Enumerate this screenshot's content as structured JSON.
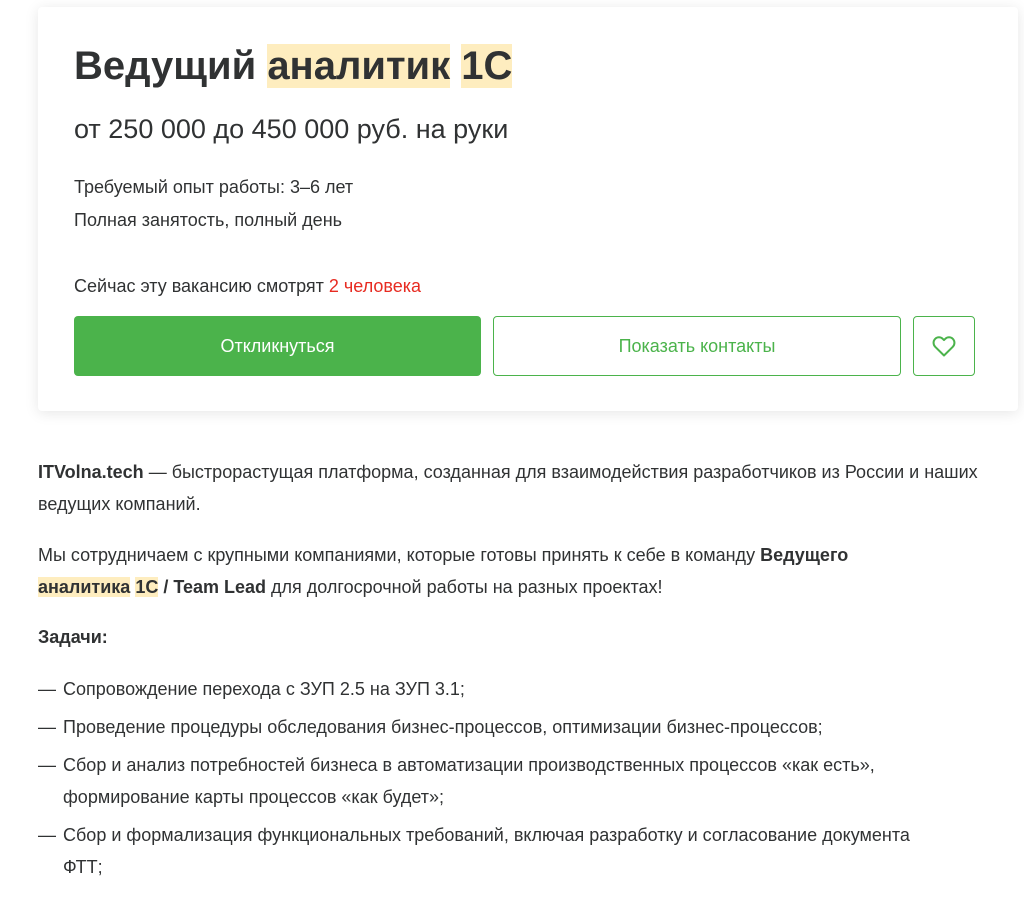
{
  "vacancy": {
    "title_part1": "Ведущий",
    "title_part2": "аналитик",
    "title_part3": "1С",
    "salary": "от 250 000 до 450 000 руб. на руки",
    "experience": "Требуемый опыт работы: 3–6 лет",
    "employment": "Полная занятость, полный день",
    "viewers_text": "Сейчас эту вакансию смотрят",
    "viewers_count": "2 человека"
  },
  "actions": {
    "respond_label": "Откликнуться",
    "contacts_label": "Показать контакты",
    "favorite_icon": "heart-icon"
  },
  "description": {
    "p1_company": "ITVolna.tech",
    "p1_text": " — быстрорастущая платформа, созданная для взаимодействия разработчиков из России и наших ведущих компаний.",
    "p2_text1": "Мы сотрудничаем с крупными компаниями, которые готовы принять к себе в команду ",
    "p2_bold1": "Ведущего",
    "p2_bold2": "аналитика",
    "p2_bold3": "1С",
    "p2_bold4": "/ Team Lead",
    "p2_text2": " для долгосрочной работы на разных проектах!",
    "tasks_heading": "Задачи:",
    "tasks": [
      "Сопровождение перехода с ЗУП 2.5 на ЗУП 3.1;",
      "Проведение процедуры обследования бизнес-процессов, оптимизации бизнес-процессов;",
      "Сбор и анализ потребностей бизнеса в автоматизации производственных процессов «как есть», формирование карты процессов «как будет»;",
      "Сбор и формализация функциональных требований, включая разработку и согласование документа ФТТ;"
    ],
    "dash": "—"
  },
  "colors": {
    "accent_green": "#4bb34b",
    "highlight": "#feedbf",
    "alert_red": "#e72b21",
    "text": "#303233"
  }
}
